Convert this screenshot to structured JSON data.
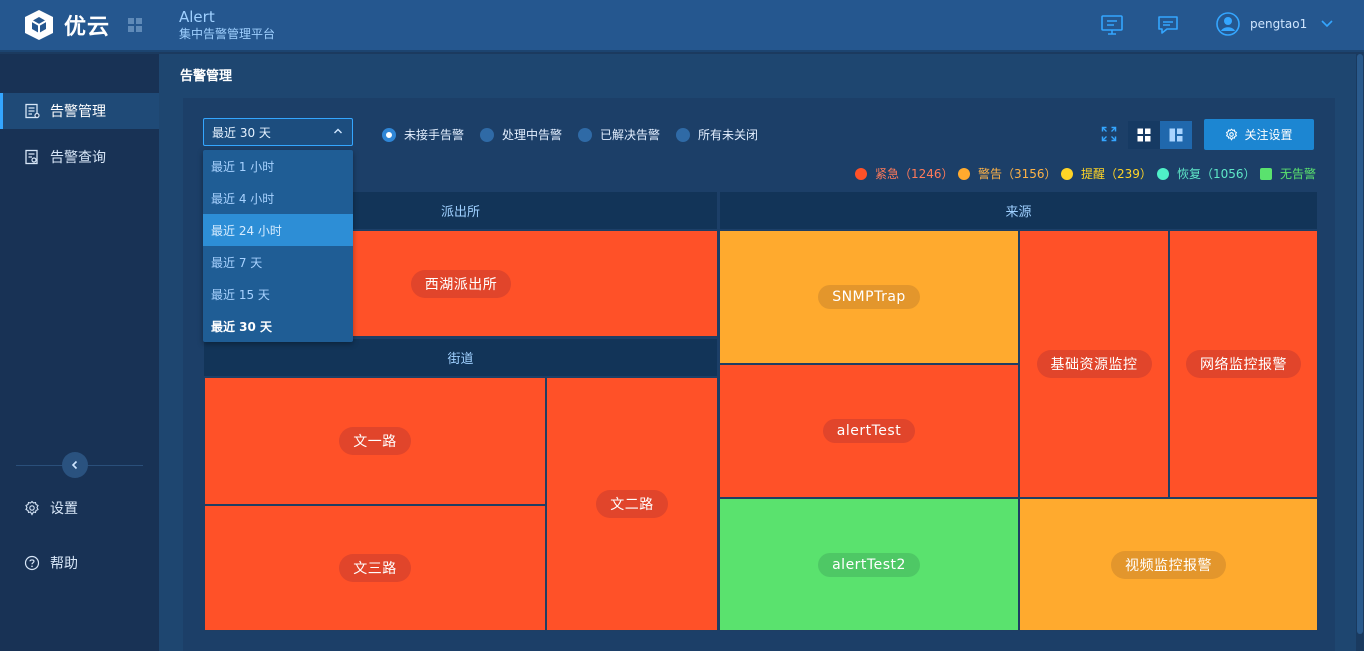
{
  "header": {
    "brand": "优云",
    "app_name": "Alert",
    "app_subtitle": "集中告警管理平台",
    "username": "pengtao1",
    "icons": [
      "monitor-icon",
      "message-icon",
      "user-avatar-icon",
      "chevron-down-icon"
    ]
  },
  "sidebar": {
    "items": [
      {
        "label": "告警管理",
        "icon": "alert-list-icon",
        "active": true
      },
      {
        "label": "告警查询",
        "icon": "alert-search-icon",
        "active": false
      }
    ],
    "bottom_items": [
      {
        "label": "设置",
        "icon": "gear-icon"
      },
      {
        "label": "帮助",
        "icon": "help-icon"
      }
    ]
  },
  "page": {
    "title": "告警管理"
  },
  "filters": {
    "time_range": "最近 30 天",
    "time_options": [
      "最近 1 小时",
      "最近 4 小时",
      "最近 24 小时",
      "最近 7 天",
      "最近 15 天",
      "最近 30 天"
    ],
    "hovered_option": "最近 24 小时",
    "status_options": [
      {
        "label": "未接手告警",
        "selected": true
      },
      {
        "label": "处理中告警",
        "selected": false
      },
      {
        "label": "已解决告警",
        "selected": false
      },
      {
        "label": "所有未关闭",
        "selected": false
      }
    ],
    "follow_button": "关注设置"
  },
  "legend": [
    {
      "label": "紧急（1246）",
      "color": "#ff5128",
      "text_color": "#ff7a5a"
    },
    {
      "label": "警告（3156）",
      "color": "#ffaa2e",
      "text_color": "#ffb347"
    },
    {
      "label": "提醒（239）",
      "color": "#ffd426",
      "text_color": "#ffd426"
    },
    {
      "label": "恢复（1056）",
      "color": "#4ff0c8",
      "text_color": "#5fe8c8"
    },
    {
      "label": "无告警",
      "color": "#5ae26e",
      "text_color": "#5ae26e"
    }
  ],
  "treemap": {
    "groups": [
      {
        "name": "派出所",
        "cells": [
          {
            "label": "西湖派出所",
            "severity": "紧急"
          }
        ]
      },
      {
        "name": "街道",
        "cells": [
          {
            "label": "文一路",
            "severity": "紧急"
          },
          {
            "label": "文三路",
            "severity": "紧急"
          },
          {
            "label": "文二路",
            "severity": "紧急"
          }
        ]
      },
      {
        "name": "来源",
        "cells": [
          {
            "label": "SNMPTrap",
            "severity": "警告"
          },
          {
            "label": "alertTest",
            "severity": "紧急"
          },
          {
            "label": "基础资源监控",
            "severity": "紧急"
          },
          {
            "label": "网络监控报警",
            "severity": "紧急"
          },
          {
            "label": "alertTest2",
            "severity": "无告警"
          },
          {
            "label": "视频监控报警",
            "severity": "警告"
          }
        ]
      }
    ]
  }
}
